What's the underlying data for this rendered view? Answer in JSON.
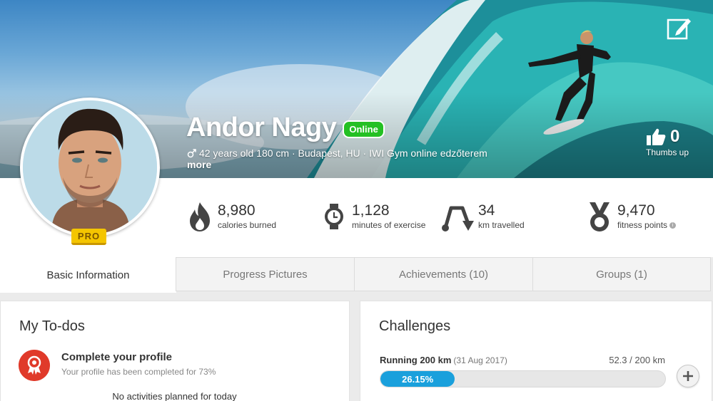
{
  "profile": {
    "name": "Andor Nagy",
    "status": "Online",
    "info": "42 years old 180 cm · Budapest, HU · IWI Gym online edzőterem",
    "more_label": "more",
    "badge": "PRO",
    "thumbs_count": "0",
    "thumbs_label": "Thumbs up"
  },
  "stats": [
    {
      "icon": "fire-icon",
      "value": "8,980",
      "label": "calories burned"
    },
    {
      "icon": "stopwatch-icon",
      "value": "1,128",
      "label": "minutes of exercise"
    },
    {
      "icon": "route-icon",
      "value": "34",
      "label": "km travelled"
    },
    {
      "icon": "medal-icon",
      "value": "9,470",
      "label": "fitness points"
    }
  ],
  "tabs": [
    {
      "label": "Basic Information",
      "active": true
    },
    {
      "label": "Progress Pictures",
      "active": false
    },
    {
      "label": "Achievements (10)",
      "active": false
    },
    {
      "label": "Groups (1)",
      "active": false
    }
  ],
  "todos": {
    "title": "My To-dos",
    "item_title": "Complete your profile",
    "item_sub": "Your profile has been completed for 73%",
    "empty": "No activities planned for today"
  },
  "challenges": {
    "title": "Challenges",
    "name": "Running 200 km",
    "date": "(31 Aug 2017)",
    "progress_text": "52.3 / 200 km",
    "percent_label": "26.15%",
    "percent": 26.15
  },
  "colors": {
    "online": "#23c023",
    "pro": "#f4c500",
    "progress": "#1aa0dc",
    "todo_icon": "#e03a2a"
  }
}
